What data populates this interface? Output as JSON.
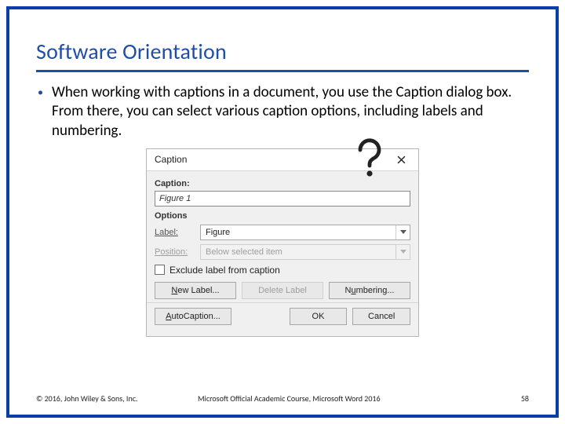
{
  "slide": {
    "title": "Software Orientation",
    "bullet": "When working with captions in a document, you use the Caption dialog box. From there, you can select various caption options, including labels and numbering."
  },
  "dialog": {
    "title": "Caption",
    "caption_label": "Caption:",
    "caption_value": "Figure 1",
    "options_label": "Options",
    "label_label": "Label:",
    "label_value": "Figure",
    "position_label": "Position:",
    "position_value": "Below selected item",
    "exclude_label": "Exclude label from caption",
    "buttons": {
      "new_label": "New Label...",
      "delete_label": "Delete Label",
      "numbering": "Numbering...",
      "autocaption": "AutoCaption...",
      "ok": "OK",
      "cancel": "Cancel"
    }
  },
  "footer": {
    "copyright": "© 2016, John Wiley & Sons, Inc.",
    "course": "Microsoft Official Academic Course, Microsoft Word 2016",
    "page": "58"
  }
}
